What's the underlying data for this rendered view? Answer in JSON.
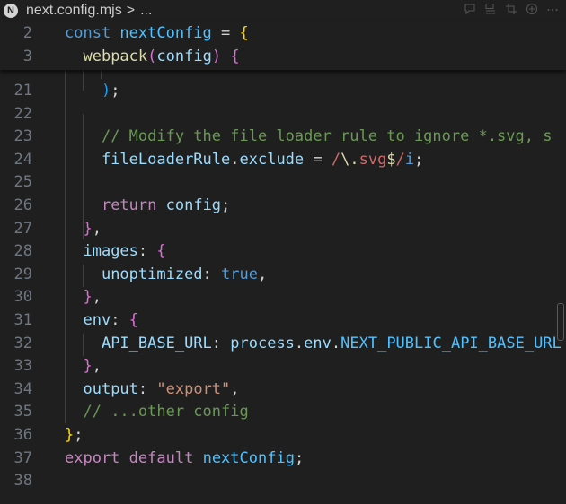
{
  "breadcrumb": {
    "file_icon_letter": "N",
    "file": "next.config.mjs",
    "separator": ">",
    "ellipsis": "..."
  },
  "toolbar": {
    "icons": [
      "comment-icon",
      "outline-icon",
      "crop-icon",
      "add-icon",
      "more-icon"
    ]
  },
  "sticky_lines": [
    {
      "number": "2",
      "tokens": [
        {
          "t": "const ",
          "c": "kw"
        },
        {
          "t": "nextConfig",
          "c": "const"
        },
        {
          "t": " = ",
          "c": "plain"
        },
        {
          "t": "{",
          "c": "br1"
        }
      ]
    },
    {
      "number": "3",
      "tokens": [
        {
          "t": "  ",
          "c": "plain"
        },
        {
          "t": "webpack",
          "c": "fn"
        },
        {
          "t": "(",
          "c": "br2"
        },
        {
          "t": "config",
          "c": "var"
        },
        {
          "t": ")",
          "c": "br2"
        },
        {
          "t": " ",
          "c": "plain"
        },
        {
          "t": "{",
          "c": "br2"
        }
      ]
    }
  ],
  "lines": [
    {
      "number": "21",
      "tokens": [
        {
          "t": "    ",
          "c": "plain"
        },
        {
          "t": ")",
          "c": "br3"
        },
        {
          "t": ";",
          "c": "plain"
        }
      ]
    },
    {
      "number": "22",
      "tokens": []
    },
    {
      "number": "23",
      "tokens": [
        {
          "t": "    ",
          "c": "plain"
        },
        {
          "t": "// Modify the file loader rule to ignore *.svg, s",
          "c": "cmt"
        }
      ]
    },
    {
      "number": "24",
      "tokens": [
        {
          "t": "    ",
          "c": "plain"
        },
        {
          "t": "fileLoaderRule",
          "c": "var"
        },
        {
          "t": ".",
          "c": "plain"
        },
        {
          "t": "exclude",
          "c": "var"
        },
        {
          "t": " = ",
          "c": "plain"
        },
        {
          "t": "/",
          "c": "re"
        },
        {
          "t": "\\.",
          "c": "rs"
        },
        {
          "t": "svg",
          "c": "re"
        },
        {
          "t": "$",
          "c": "rs"
        },
        {
          "t": "/",
          "c": "re"
        },
        {
          "t": "i",
          "c": "kw"
        },
        {
          "t": ";",
          "c": "plain"
        }
      ]
    },
    {
      "number": "25",
      "tokens": []
    },
    {
      "number": "26",
      "tokens": [
        {
          "t": "    ",
          "c": "plain"
        },
        {
          "t": "return",
          "c": "ctl"
        },
        {
          "t": " ",
          "c": "plain"
        },
        {
          "t": "config",
          "c": "var"
        },
        {
          "t": ";",
          "c": "plain"
        }
      ]
    },
    {
      "number": "27",
      "tokens": [
        {
          "t": "  ",
          "c": "plain"
        },
        {
          "t": "}",
          "c": "br2"
        },
        {
          "t": ",",
          "c": "plain"
        }
      ]
    },
    {
      "number": "28",
      "tokens": [
        {
          "t": "  ",
          "c": "plain"
        },
        {
          "t": "images",
          "c": "var"
        },
        {
          "t": ": ",
          "c": "plain"
        },
        {
          "t": "{",
          "c": "br2"
        }
      ]
    },
    {
      "number": "29",
      "tokens": [
        {
          "t": "    ",
          "c": "plain"
        },
        {
          "t": "unoptimized",
          "c": "var"
        },
        {
          "t": ": ",
          "c": "plain"
        },
        {
          "t": "true",
          "c": "kw"
        },
        {
          "t": ",",
          "c": "plain"
        }
      ]
    },
    {
      "number": "30",
      "tokens": [
        {
          "t": "  ",
          "c": "plain"
        },
        {
          "t": "}",
          "c": "br2"
        },
        {
          "t": ",",
          "c": "plain"
        }
      ]
    },
    {
      "number": "31",
      "tokens": [
        {
          "t": "  ",
          "c": "plain"
        },
        {
          "t": "env",
          "c": "var"
        },
        {
          "t": ": ",
          "c": "plain"
        },
        {
          "t": "{",
          "c": "br2"
        }
      ]
    },
    {
      "number": "32",
      "tokens": [
        {
          "t": "    ",
          "c": "plain"
        },
        {
          "t": "API_BASE_URL",
          "c": "var"
        },
        {
          "t": ": ",
          "c": "plain"
        },
        {
          "t": "process",
          "c": "var"
        },
        {
          "t": ".",
          "c": "plain"
        },
        {
          "t": "env",
          "c": "var"
        },
        {
          "t": ".",
          "c": "plain"
        },
        {
          "t": "NEXT_PUBLIC_API_BASE_URL",
          "c": "const"
        }
      ]
    },
    {
      "number": "33",
      "tokens": [
        {
          "t": "  ",
          "c": "plain"
        },
        {
          "t": "}",
          "c": "br2"
        },
        {
          "t": ",",
          "c": "plain"
        }
      ]
    },
    {
      "number": "34",
      "tokens": [
        {
          "t": "  ",
          "c": "plain"
        },
        {
          "t": "output",
          "c": "var"
        },
        {
          "t": ": ",
          "c": "plain"
        },
        {
          "t": "\"export\"",
          "c": "str"
        },
        {
          "t": ",",
          "c": "plain"
        }
      ]
    },
    {
      "number": "35",
      "tokens": [
        {
          "t": "  ",
          "c": "plain"
        },
        {
          "t": "// ...other config",
          "c": "cmt"
        }
      ]
    },
    {
      "number": "36",
      "tokens": [
        {
          "t": "}",
          "c": "br1"
        },
        {
          "t": ";",
          "c": "plain"
        }
      ]
    },
    {
      "number": "37",
      "tokens": [
        {
          "t": "export",
          "c": "ctl"
        },
        {
          "t": " ",
          "c": "plain"
        },
        {
          "t": "default",
          "c": "ctl"
        },
        {
          "t": " ",
          "c": "plain"
        },
        {
          "t": "nextConfig",
          "c": "const"
        },
        {
          "t": ";",
          "c": "plain"
        }
      ]
    },
    {
      "number": "38",
      "tokens": []
    }
  ],
  "colors": {
    "background": "#1f1f1f",
    "keyword": "#569cd6",
    "control": "#c586c0",
    "variable": "#9cdcfe",
    "function": "#dcdcaa",
    "string": "#ce9178",
    "comment": "#6a9955",
    "constant": "#4fc1ff",
    "bracket_1": "#ffd700",
    "bracket_2": "#da70d6",
    "bracket_3": "#179fff"
  }
}
